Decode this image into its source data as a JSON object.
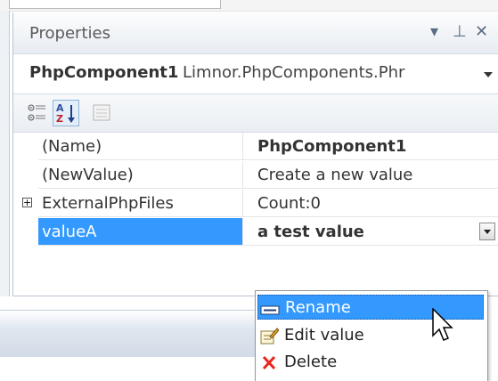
{
  "panel": {
    "title": "Properties",
    "buttons": [
      {
        "name": "panel-dropdown-button",
        "glyph": "▾"
      },
      {
        "name": "pin-button",
        "glyph": "⊥"
      },
      {
        "name": "close-button",
        "glyph": "✕"
      }
    ]
  },
  "object_selector": {
    "name": "PhpComponent1",
    "type": "Limnor.PhpComponents.Phr"
  },
  "toolbar": {
    "buttons": [
      {
        "name": "categorized-view-button",
        "icon": "categorized-icon",
        "selected": false
      },
      {
        "name": "alphabetical-view-button",
        "icon": "sort-az-icon",
        "selected": true
      },
      {
        "name": "property-pages-button",
        "icon": "property-pages-icon",
        "selected": false
      }
    ]
  },
  "properties": [
    {
      "name": "(Name)",
      "value": "PhpComponent1",
      "bold_value": true,
      "expandable": false,
      "selected": false
    },
    {
      "name": "(NewValue)",
      "value": "Create a new value",
      "bold_value": false,
      "expandable": false,
      "selected": false
    },
    {
      "name": "ExternalPhpFiles",
      "value": "Count:0",
      "bold_value": false,
      "expandable": true,
      "selected": false
    },
    {
      "name": "valueA",
      "value": "a test value",
      "bold_value": true,
      "expandable": false,
      "selected": true
    }
  ],
  "context_menu": {
    "items": [
      {
        "label": "Rename",
        "icon": "rename-icon",
        "highlighted": true
      },
      {
        "label": "Edit value",
        "icon": "edit-value-icon",
        "highlighted": false
      },
      {
        "label": "Delete",
        "icon": "delete-icon",
        "highlighted": false
      }
    ]
  },
  "colors": {
    "selection": "#3399ff",
    "delete": "#e8261c"
  }
}
